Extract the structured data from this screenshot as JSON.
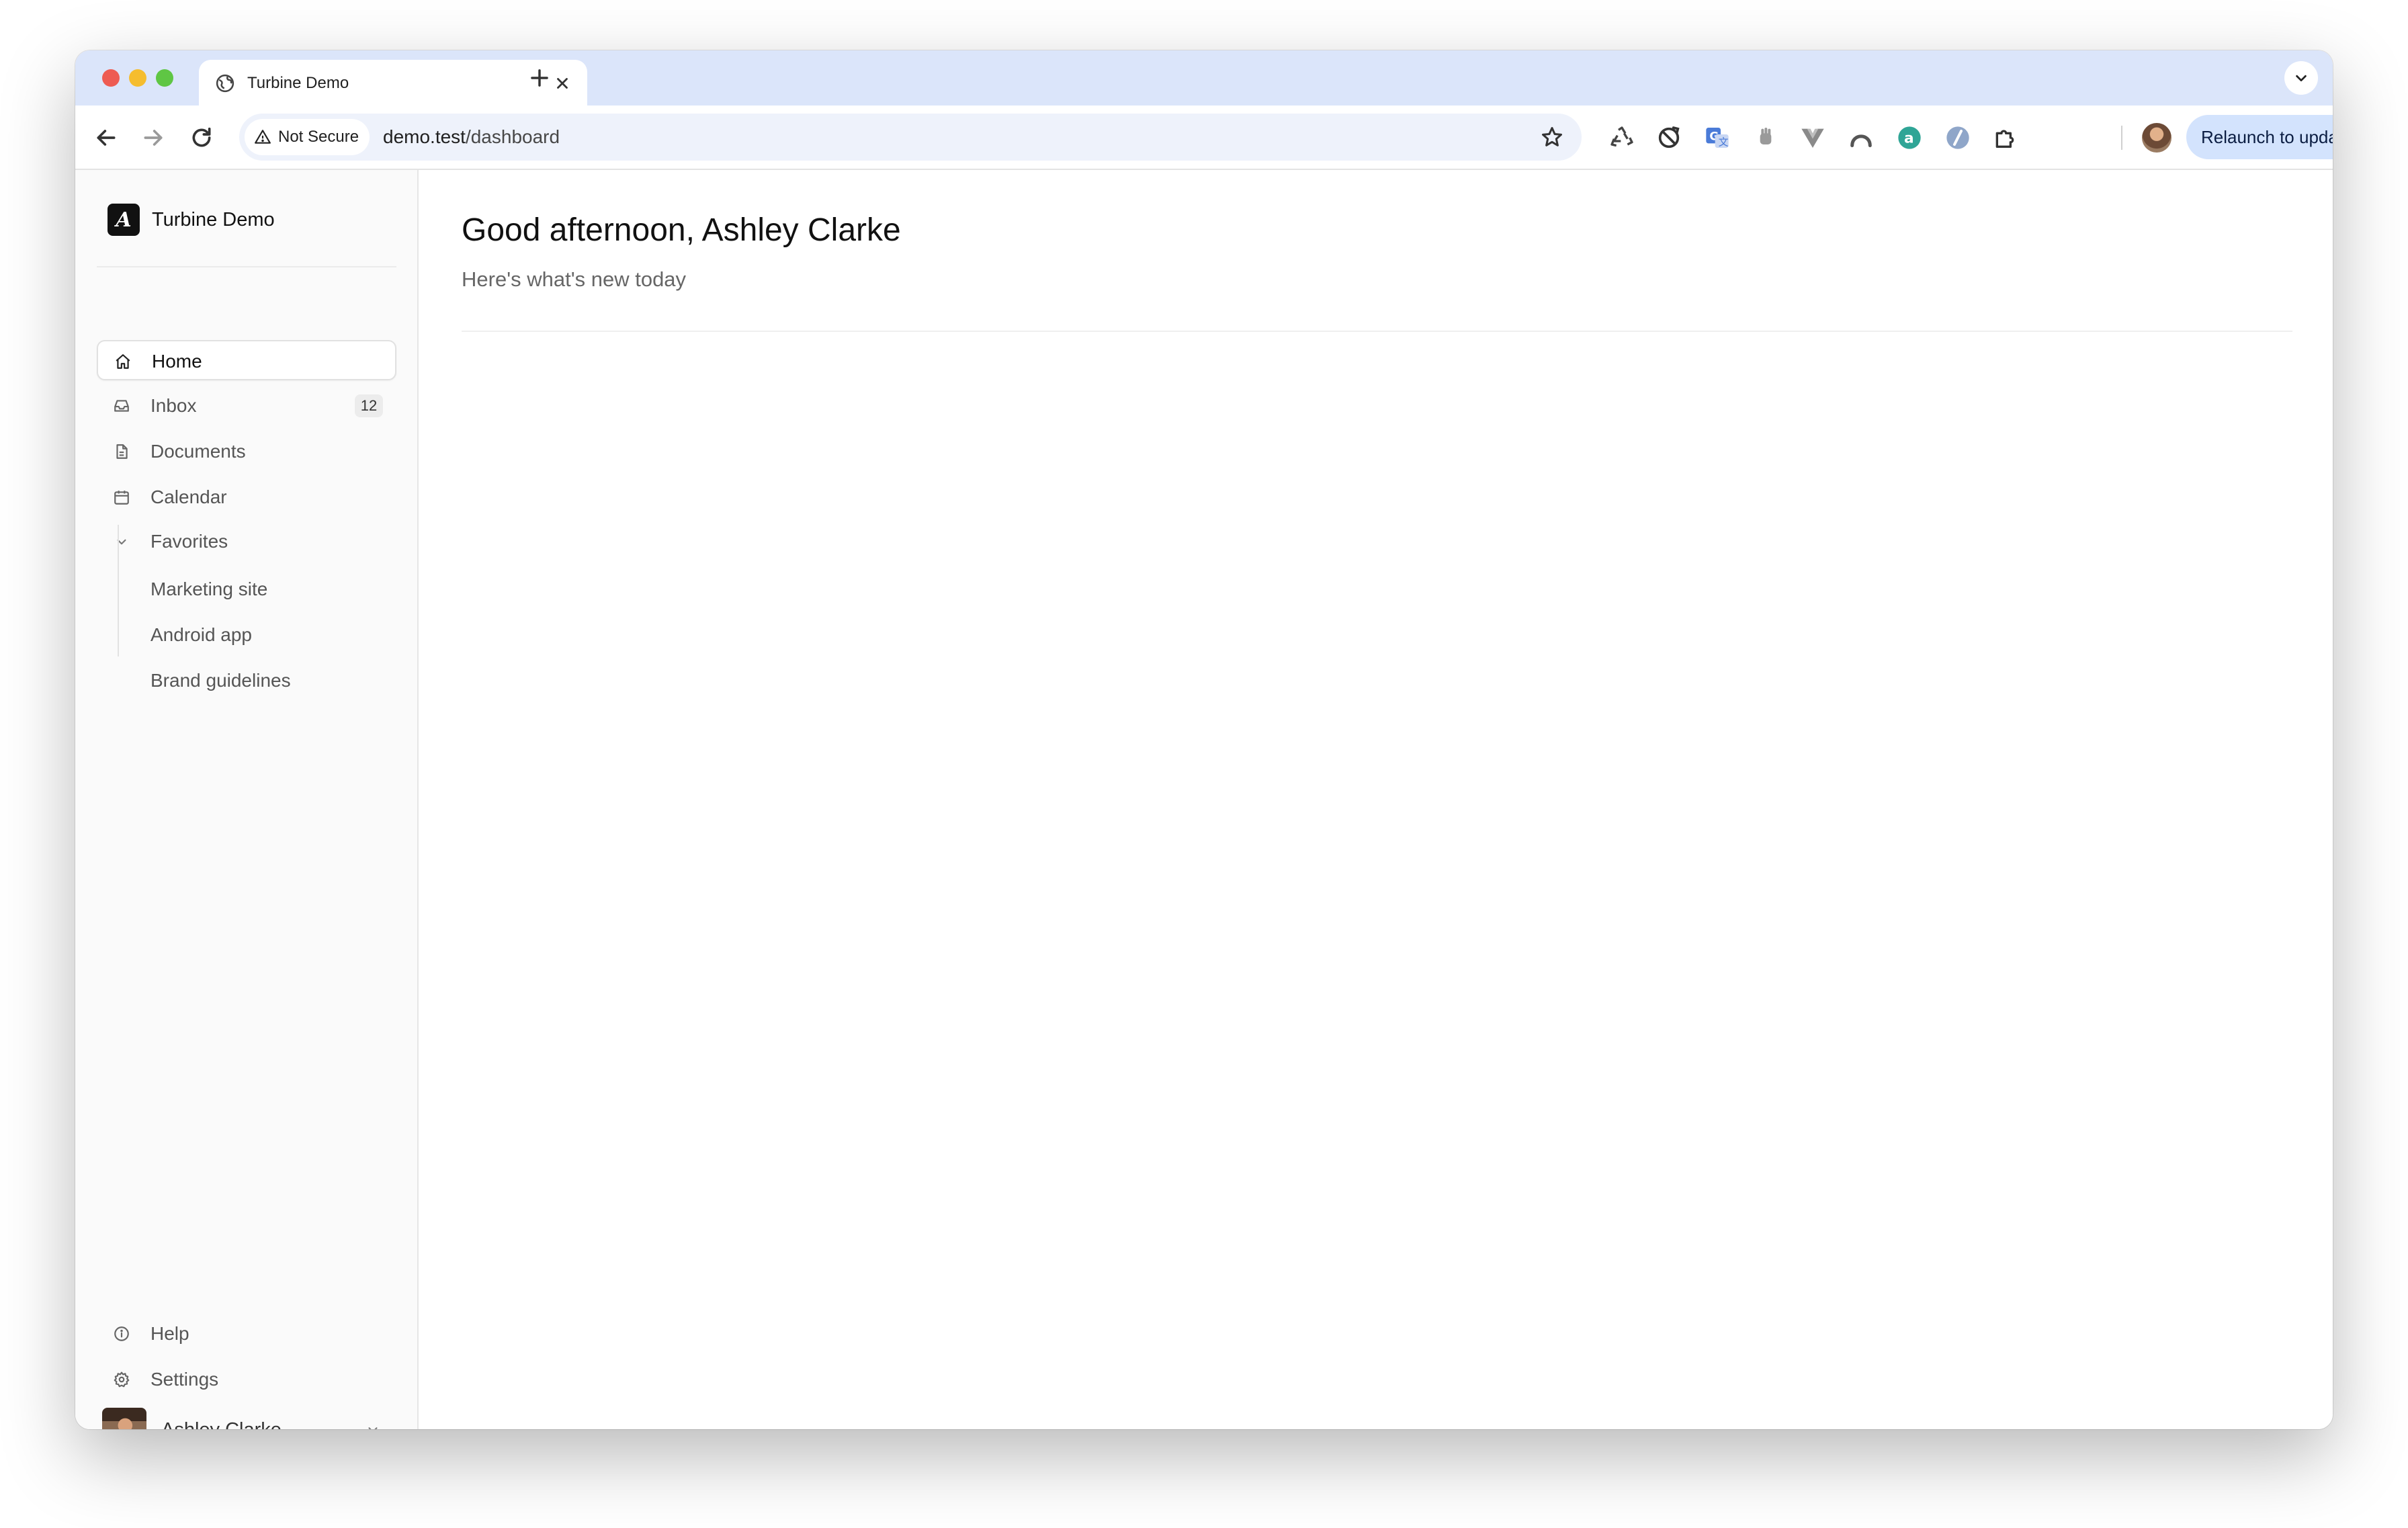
{
  "browser": {
    "tab_title": "Turbine Demo",
    "security_label": "Not Secure",
    "url_host": "demo.test",
    "url_path": "/dashboard",
    "relaunch_label": "Relaunch to update"
  },
  "sidebar": {
    "brand_name": "Turbine Demo",
    "brand_logo_letter": "A",
    "items": [
      {
        "label": "Home",
        "icon": "home-icon",
        "active": true
      },
      {
        "label": "Inbox",
        "icon": "inbox-icon",
        "badge": "12"
      },
      {
        "label": "Documents",
        "icon": "document-icon"
      },
      {
        "label": "Calendar",
        "icon": "calendar-icon"
      }
    ],
    "favorites": {
      "label": "Favorites",
      "items": [
        "Marketing site",
        "Android app",
        "Brand guidelines"
      ]
    },
    "footer": [
      {
        "label": "Help",
        "icon": "info-icon"
      },
      {
        "label": "Settings",
        "icon": "gear-icon"
      }
    ],
    "user": {
      "name": "Ashley Clarke"
    }
  },
  "main": {
    "greeting": "Good afternoon, Ashley Clarke",
    "subtitle": "Here's what's new today"
  },
  "colors": {
    "tabstrip": "#dbe5fa",
    "relaunch_bg": "#d3e3fd",
    "sidebar_bg": "#fafafa"
  }
}
